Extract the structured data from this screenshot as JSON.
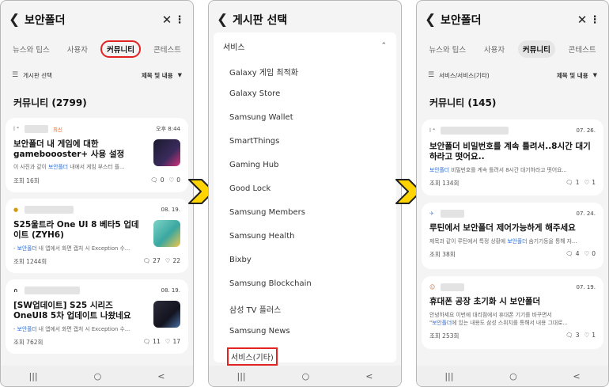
{
  "screen1": {
    "title": "보안폴더",
    "tabs": [
      "뉴스와 팁스",
      "사용자",
      "커뮤니티",
      "콘테스트"
    ],
    "filter_left": "게시판 선택",
    "filter_right": "제목 및 내용",
    "section": "커뮤니티 (2799)",
    "posts": [
      {
        "badge": "최신",
        "date": "오후 8:44",
        "title": "보안폴더 내 게임에 대한 gameboooster+ 사용 설정",
        "desc_pre": "이 사진과 같이 ",
        "desc_hl": "보안폴더",
        "desc_post": " 내에서 게임 부스터 플...",
        "views": "조회 16회",
        "comments": "0",
        "likes": "0"
      },
      {
        "badge": "",
        "date": "08. 19.",
        "title": "S25울트라 One UI 8 베타5 업데이트 (ZYH6)",
        "desc_pre": "- ",
        "desc_hl": "보안폴더",
        "desc_post": " 내 앱에서 화면 캡처 시 Exception 수...",
        "views": "조회 1244회",
        "comments": "27",
        "likes": "22"
      },
      {
        "badge": "",
        "date": "08. 19.",
        "title": "[SW업데이트] S25 시리즈 OneUI8 5차 업데이트 나왔네요",
        "desc_pre": "- ",
        "desc_hl": "보안폴더",
        "desc_post": " 내 앱에서 화면 캡처 시 Exception 수...",
        "views": "조회 762회",
        "comments": "11",
        "likes": "17"
      }
    ]
  },
  "screen2": {
    "title": "게시판 선택",
    "category": "서비스",
    "items": [
      "Galaxy 게임 최적화",
      "Galaxy Store",
      "Samsung Wallet",
      "SmartThings",
      "Gaming Hub",
      "Good Lock",
      "Samsung Members",
      "Samsung Health",
      "Bixby",
      "Samsung Blockchain",
      "삼성 TV 플러스",
      "Samsung News",
      "서비스(기타)"
    ]
  },
  "screen3": {
    "title": "보안폴더",
    "tabs": [
      "뉴스와 팁스",
      "사용자",
      "커뮤니티",
      "콘테스트"
    ],
    "filter_left": "서비스/서비스(기타)",
    "filter_right": "제목 및 내용",
    "section": "커뮤니티 (145)",
    "posts": [
      {
        "date": "07. 26.",
        "title": "보안폴더 비밀번호를 계속 틀려서..8시간 대기하라고 떳어요..",
        "desc_pre": "",
        "desc_hl": "보안폴더",
        "desc_post": " 비밀번호를 계속 틀려서 8시간 대기하라고 떳어요...",
        "views": "조회 134회",
        "comments": "1",
        "likes": "1"
      },
      {
        "date": "07. 24.",
        "title": "루틴에서 보안폴더 제어가능하게 해주세요",
        "desc_pre": "제목과 같이 루틴에서 특정 상황에 ",
        "desc_hl": "보안폴더",
        "desc_post": " 숨기기등을 통해 자...",
        "views": "조회 38회",
        "comments": "4",
        "likes": "0"
      },
      {
        "date": "07. 19.",
        "title": "휴대폰 공장 초기화 시 보안폴더",
        "desc_pre": "안녕하세요 이번에 대리점에서 휴대폰 기기를 바꾸면서",
        "desc_hl": "",
        "desc_post": "",
        "desc2_pre": "\"",
        "desc2_hl": "보안폴더",
        "desc2_post": "에 있는 내용도 삼성 스위치를 통해서 내용 그대로...",
        "views": "조회 253회",
        "comments": "3",
        "likes": "1"
      }
    ]
  },
  "navbar": [
    "|||",
    "○",
    "<"
  ],
  "colors": {
    "highlight_red": "#e32222",
    "arrow_yellow": "#ffd400",
    "link_blue": "#2f6ed6",
    "hot_orange": "#e8641a"
  }
}
